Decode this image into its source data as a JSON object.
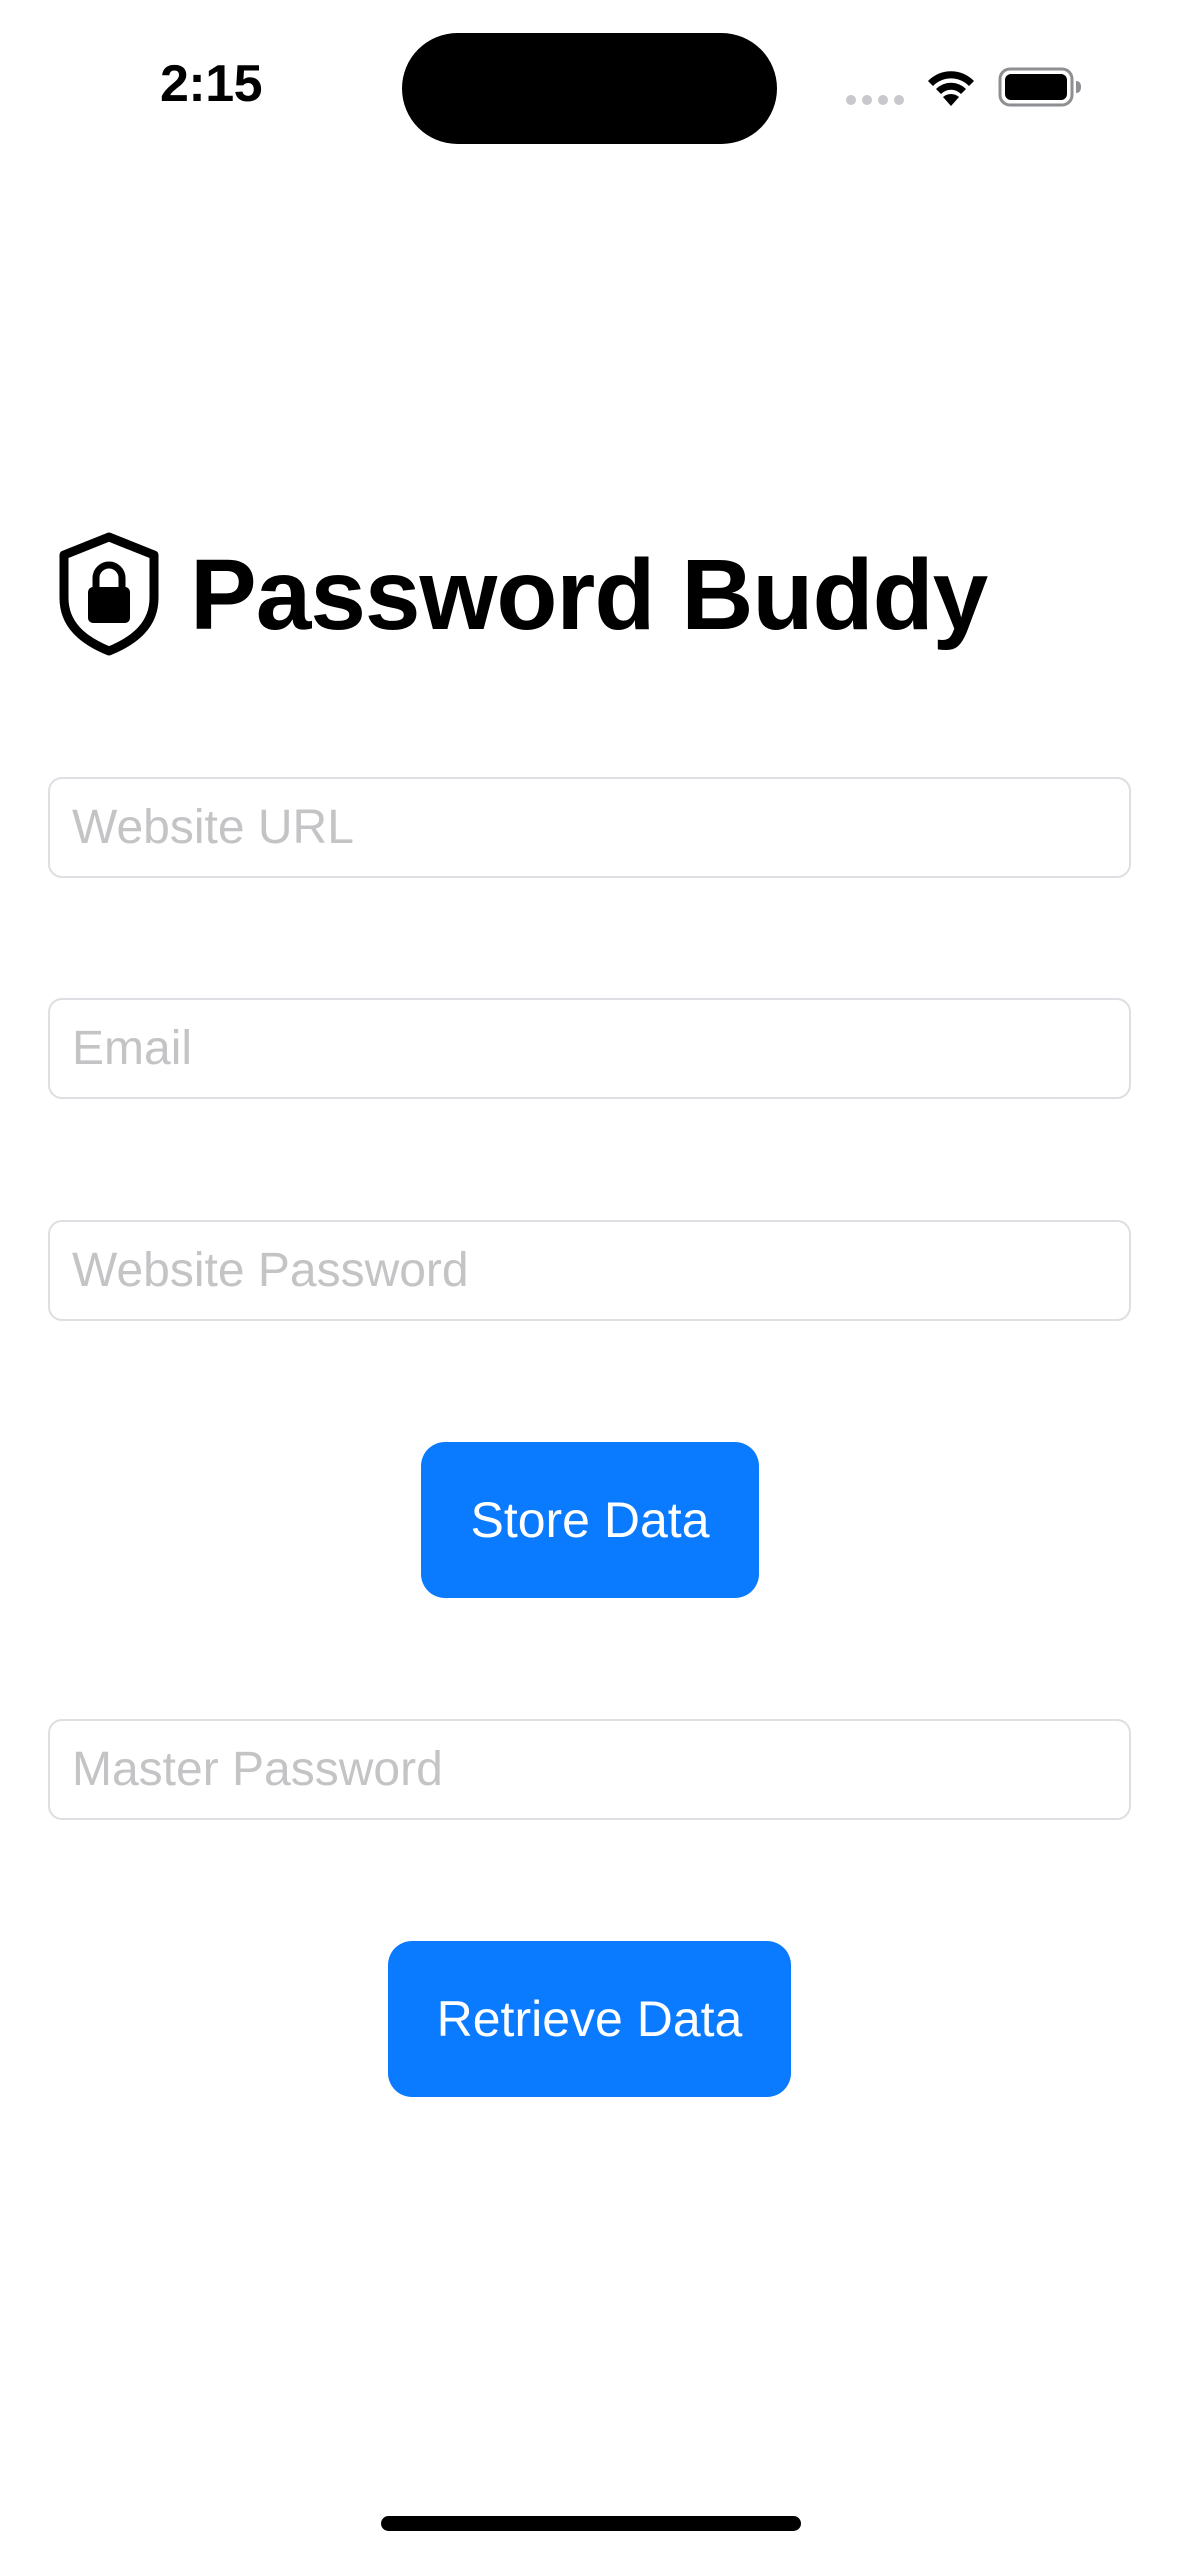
{
  "status_bar": {
    "time": "2:15",
    "icons": [
      "cellular-signal-icon",
      "wifi-icon",
      "battery-icon"
    ]
  },
  "header": {
    "icon": "shield-lock-icon",
    "title": "Password Buddy"
  },
  "form": {
    "website_url": {
      "placeholder": "Website URL",
      "value": ""
    },
    "email": {
      "placeholder": "Email",
      "value": ""
    },
    "website_password": {
      "placeholder": "Website Password",
      "value": ""
    },
    "store_button": "Store Data",
    "master_password": {
      "placeholder": "Master Password",
      "value": ""
    },
    "retrieve_button": "Retrieve Data"
  },
  "colors": {
    "accent": "#0a7aff",
    "field_border": "#dedee3",
    "placeholder": "#c4c4c7",
    "background": "#ffffff"
  }
}
